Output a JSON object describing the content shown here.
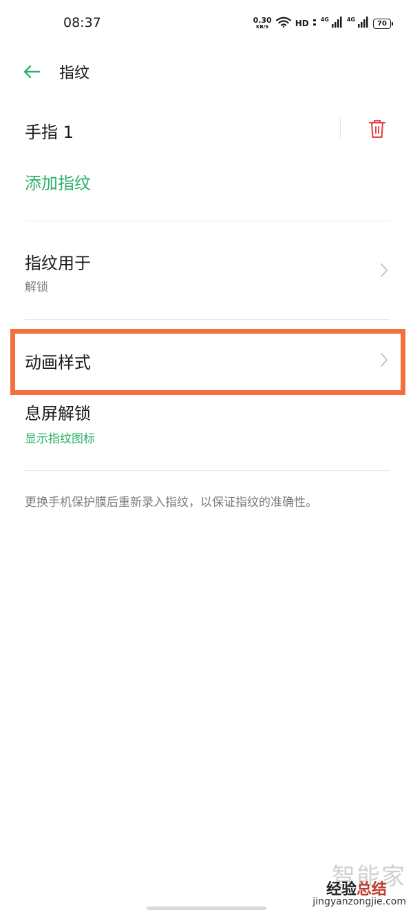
{
  "status_bar": {
    "time": "08:37",
    "net_speed_value": "0.30",
    "net_speed_unit": "KB/S",
    "hd_label": "HD",
    "signal1_label": "4G",
    "signal2_label": "4G",
    "battery_level": "70",
    "icons": [
      "wifi-icon",
      "signal-icon",
      "battery-icon"
    ]
  },
  "header": {
    "title": "指纹",
    "back_icon": "back-arrow-icon"
  },
  "fingerprints": [
    {
      "name": "手指 1",
      "delete_icon": "trash-icon"
    }
  ],
  "add_fingerprint_label": "添加指纹",
  "settings": {
    "fingerprint_use": {
      "title": "指纹用于",
      "subtitle": "解锁"
    },
    "animation_style": {
      "title": "动画样式"
    },
    "screen_off_unlock": {
      "title": "息屏解锁",
      "subtitle": "显示指纹图标"
    }
  },
  "note": "更换手机保护膜后重新录入指纹，以保证指纹的准确性。",
  "watermark": {
    "main": "智能家",
    "sub_black": "经验",
    "sub_red": "总结",
    "url": "jingyanzongjie.com"
  },
  "colors": {
    "accent_green": "#2ab26a",
    "delete_red": "#e5484d",
    "highlight_orange": "#f36f3b",
    "text_primary": "#1a1a1a",
    "text_secondary": "#808080"
  }
}
